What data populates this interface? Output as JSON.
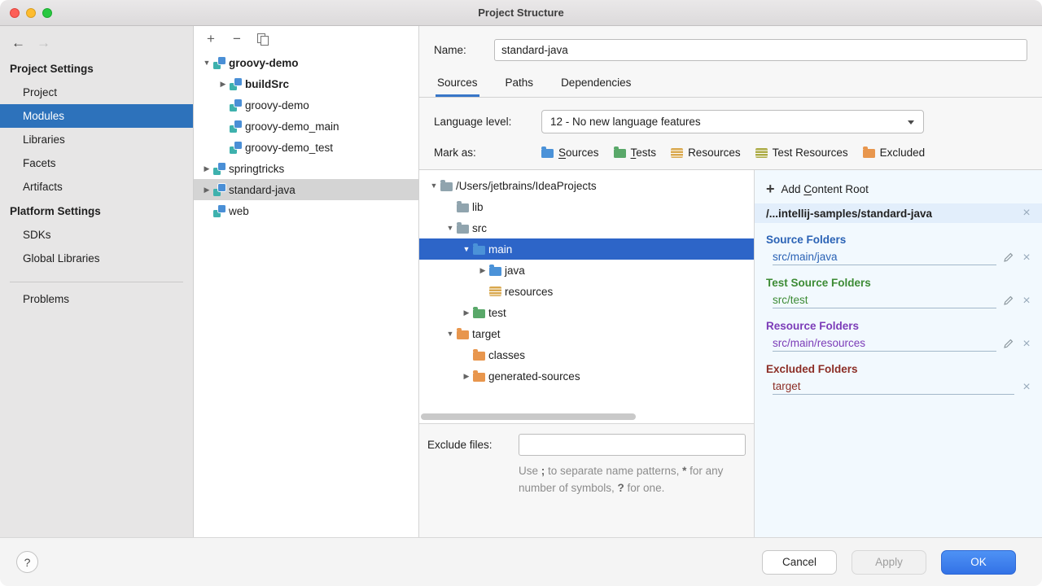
{
  "window": {
    "title": "Project Structure"
  },
  "colors": {
    "sidebar_selection": "#2d72bb",
    "tree_selection": "#2d65c8",
    "tab_accent": "#3876c8",
    "source_blue": "#2a62b5",
    "test_green": "#3c8b34",
    "resource_purple": "#7c3cb8",
    "excluded_maroon": "#8c2e26",
    "folder_gray": "#90a4ae",
    "folder_source": "#4b92d8",
    "folder_test": "#59a869",
    "folder_excluded": "#e8964d",
    "resource_gold": "#d9a84e",
    "test_resource_olive": "#acab45"
  },
  "sidebar": {
    "back_glyph": "←",
    "forward_glyph": "→",
    "sections": [
      {
        "header": "Project Settings",
        "items": [
          {
            "label": "Project",
            "selected": false
          },
          {
            "label": "Modules",
            "selected": true
          },
          {
            "label": "Libraries",
            "selected": false
          },
          {
            "label": "Facets",
            "selected": false
          },
          {
            "label": "Artifacts",
            "selected": false
          }
        ]
      },
      {
        "header": "Platform Settings",
        "items": [
          {
            "label": "SDKs",
            "selected": false
          },
          {
            "label": "Global Libraries",
            "selected": false
          }
        ]
      }
    ],
    "footer_item": {
      "label": "Problems"
    }
  },
  "module_panel": {
    "toolbar": {
      "add_glyph": "+",
      "remove_glyph": "−"
    },
    "tree": [
      {
        "label": "groovy-demo",
        "level": 0,
        "arrow": "expanded",
        "bold": true
      },
      {
        "label": "buildSrc",
        "level": 1,
        "arrow": "collapsed",
        "bold": true
      },
      {
        "label": "groovy-demo",
        "level": 1
      },
      {
        "label": "groovy-demo_main",
        "level": 1
      },
      {
        "label": "groovy-demo_test",
        "level": 1
      },
      {
        "label": "springtricks",
        "level": 0,
        "arrow": "collapsed"
      },
      {
        "label": "standard-java",
        "level": 0,
        "arrow": "collapsed",
        "selected": true
      },
      {
        "label": "web",
        "level": 0
      }
    ]
  },
  "module_editor": {
    "name_label": "Name:",
    "name_value": "standard-java",
    "tabs": [
      {
        "label": "Sources",
        "active": true
      },
      {
        "label": "Paths",
        "active": false
      },
      {
        "label": "Dependencies",
        "active": false
      }
    ],
    "language_level": {
      "label": "Language level:",
      "value": "12 - No new language features"
    },
    "mark_as": {
      "label": "Mark as:",
      "options": [
        {
          "label": "Sources",
          "mnemonic": "S",
          "icon": "folder-source"
        },
        {
          "label": "Tests",
          "mnemonic": "T",
          "icon": "folder-test"
        },
        {
          "label": "Resources",
          "mnemonic": "",
          "icon": "stack-resource"
        },
        {
          "label": "Test Resources",
          "mnemonic": "",
          "icon": "stack-test-resource"
        },
        {
          "label": "Excluded",
          "mnemonic": "",
          "icon": "folder-excluded"
        }
      ]
    }
  },
  "file_tree": {
    "rows": [
      {
        "label": "/Users/jetbrains/IdeaProjects",
        "level": 0,
        "arrow": "expanded",
        "icon": "folder"
      },
      {
        "label": "lib",
        "level": 1,
        "arrow": "none",
        "icon": "folder"
      },
      {
        "label": "src",
        "level": 1,
        "arrow": "expanded",
        "icon": "folder"
      },
      {
        "label": "main",
        "level": 2,
        "arrow": "expanded",
        "icon": "folder-source",
        "selected": true
      },
      {
        "label": "java",
        "level": 3,
        "arrow": "collapsed",
        "icon": "folder-source"
      },
      {
        "label": "resources",
        "level": 3,
        "arrow": "none",
        "icon": "stack-resource"
      },
      {
        "label": "test",
        "level": 2,
        "arrow": "collapsed",
        "icon": "folder-test"
      },
      {
        "label": "target",
        "level": 1,
        "arrow": "expanded",
        "icon": "folder-excluded"
      },
      {
        "label": "classes",
        "level": 2,
        "arrow": "none",
        "icon": "folder-excluded"
      },
      {
        "label": "generated-sources",
        "level": 2,
        "arrow": "collapsed",
        "icon": "folder-excluded"
      }
    ],
    "exclude": {
      "label": "Exclude files:",
      "value": "",
      "hint_parts": [
        {
          "t": "Use "
        },
        {
          "t": ";",
          "b": true
        },
        {
          "t": " to separate name patterns, "
        },
        {
          "t": "*",
          "b": true
        },
        {
          "t": " for any number of symbols, "
        },
        {
          "t": "?",
          "b": true
        },
        {
          "t": " for one."
        }
      ]
    }
  },
  "content_roots": {
    "add": {
      "label": "Add Content Root",
      "mnemonic": "C"
    },
    "root": {
      "path": "/...intellij-samples/standard-java"
    },
    "groups": [
      {
        "title": "Source Folders",
        "color_key": "source_blue",
        "folders": [
          {
            "path": "src/main/java",
            "editable": true
          }
        ]
      },
      {
        "title": "Test Source Folders",
        "color_key": "test_green",
        "folders": [
          {
            "path": "src/test",
            "editable": true
          }
        ]
      },
      {
        "title": "Resource Folders",
        "color_key": "resource_purple",
        "folders": [
          {
            "path": "src/main/resources",
            "editable": true
          }
        ]
      },
      {
        "title": "Excluded Folders",
        "color_key": "excluded_maroon",
        "folders": [
          {
            "path": "target",
            "editable": false
          }
        ]
      }
    ]
  },
  "footer": {
    "help": "?",
    "buttons": [
      {
        "label": "Cancel",
        "style": "default"
      },
      {
        "label": "Apply",
        "style": "disabled"
      },
      {
        "label": "OK",
        "style": "primary"
      }
    ]
  }
}
